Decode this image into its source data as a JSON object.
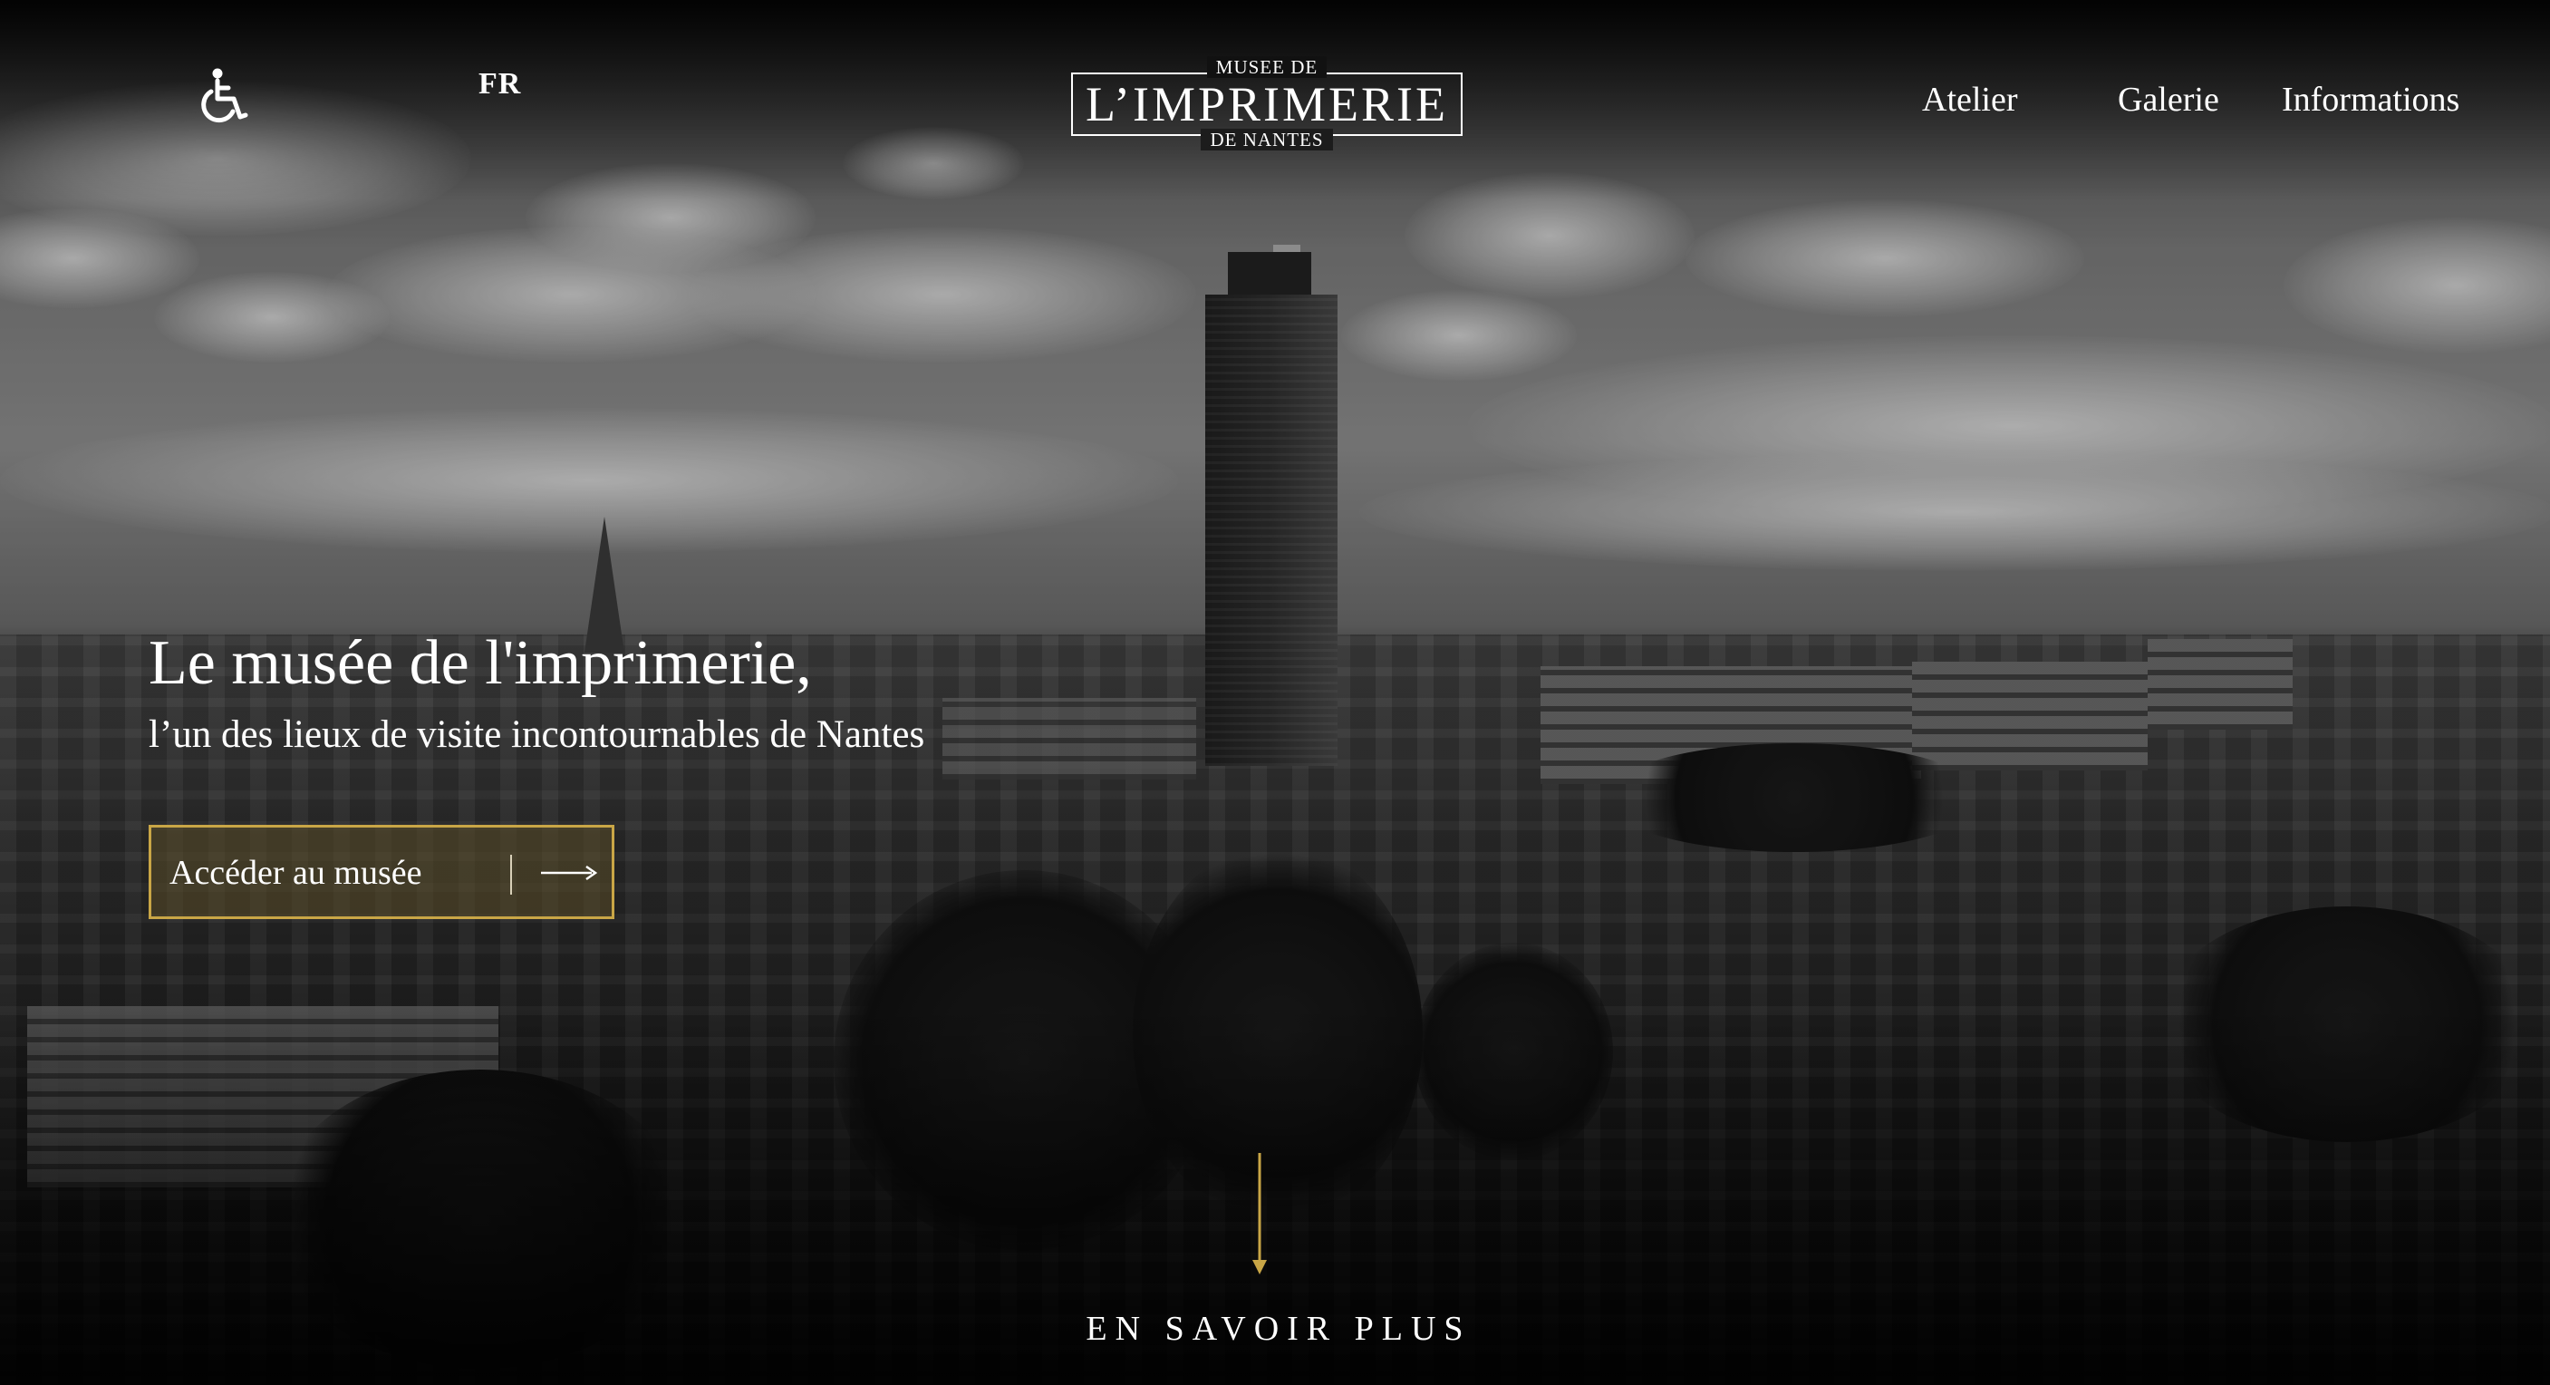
{
  "header": {
    "accessibility_icon": "wheelchair-icon",
    "language": "FR",
    "logo": {
      "top": "MUSEE DE",
      "main": "L’IMPRIMERIE",
      "bottom": "DE NANTES"
    },
    "nav": [
      "Atelier",
      "Galerie",
      "Informations"
    ]
  },
  "hero": {
    "title": "Le musée de l'imprimerie,",
    "subtitle": "l’un des lieux de visite incontournables de Nantes",
    "cta_label": "Accéder au musée",
    "cta_icon": "arrow-right-icon"
  },
  "scroll": {
    "icon": "arrow-down-icon",
    "label": "EN SAVOIR PLUS"
  },
  "colors": {
    "accent_gold": "#c9a646",
    "text": "#ffffff"
  }
}
